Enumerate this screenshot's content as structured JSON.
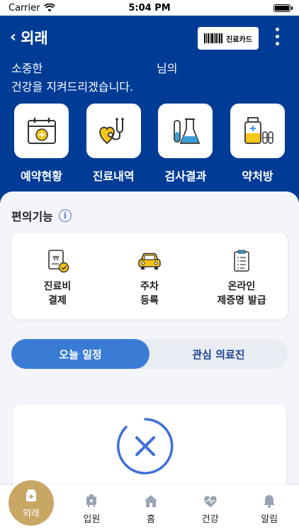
{
  "status": {
    "carrier": "Carrier",
    "time": "5:04 PM",
    "battery_level": 1.0
  },
  "header": {
    "title": "외래",
    "card_button": "진료카드",
    "greeting_prefix": "소중한",
    "greeting_suffix": "님의",
    "greeting_line2": "건강을 지켜드리겠습니다."
  },
  "shortcuts": [
    {
      "icon": "calendar-plus-icon",
      "label": "예약현황"
    },
    {
      "icon": "stethoscope-heart-icon",
      "label": "진료내역"
    },
    {
      "icon": "lab-flask-icon",
      "label": "검사결과"
    },
    {
      "icon": "medicine-bottle-icon",
      "label": "약처방"
    }
  ],
  "convenience": {
    "title": "편의기능",
    "items": [
      {
        "icon": "payment-bill-icon",
        "line1": "진료비",
        "line2": "결제"
      },
      {
        "icon": "car-icon",
        "line1": "주차",
        "line2": "등록"
      },
      {
        "icon": "clipboard-icon",
        "line1": "온라인",
        "line2": "제증명 발급"
      }
    ]
  },
  "toggle": {
    "active": "오늘 일정",
    "inactive": "관심 의료진"
  },
  "tabbar": [
    {
      "icon": "outpatient-icon",
      "label": "외래",
      "active": true
    },
    {
      "icon": "inpatient-icon",
      "label": "입원",
      "active": false
    },
    {
      "icon": "home-icon",
      "label": "홈",
      "active": false
    },
    {
      "icon": "health-heart-icon",
      "label": "건강",
      "active": false
    },
    {
      "icon": "bell-icon",
      "label": "알림",
      "active": false
    }
  ],
  "colors": {
    "primary": "#003c96",
    "accent": "#3a7bd5",
    "gold": "#c8a765",
    "highlight": "#f5c518"
  }
}
